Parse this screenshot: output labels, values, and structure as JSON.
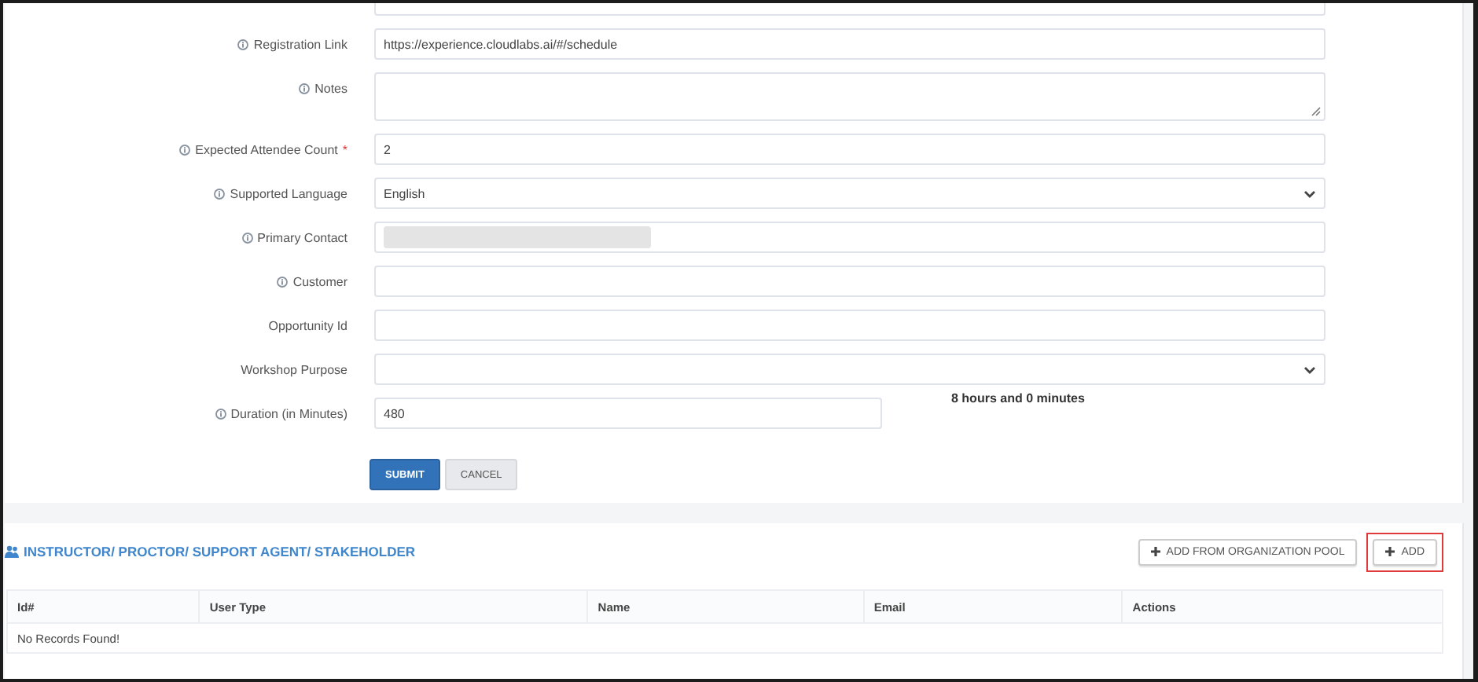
{
  "form": {
    "top_cut_field": true,
    "rows": [
      {
        "label": "Registration Link",
        "info": true,
        "required": false,
        "kind": "text",
        "value": "https://experience.cloudlabs.ai/#/schedule"
      },
      {
        "label": "Notes",
        "info": true,
        "required": false,
        "kind": "textarea"
      },
      {
        "label": "Expected Attendee Count",
        "info": true,
        "required": true,
        "required_mark": "*",
        "kind": "text",
        "value": "2"
      },
      {
        "label": "Supported Language",
        "info": true,
        "required": false,
        "kind": "select",
        "value": "English"
      },
      {
        "label": "Primary Contact",
        "info": true,
        "required": false,
        "kind": "blurred"
      },
      {
        "label": "Customer",
        "info": true,
        "required": false,
        "kind": "text"
      },
      {
        "label": "Opportunity Id",
        "info": false,
        "required": false,
        "kind": "text"
      },
      {
        "label": "Workshop Purpose",
        "info": false,
        "required": false,
        "kind": "select"
      },
      {
        "label": "Duration (in Minutes)",
        "info": true,
        "required": false,
        "kind": "short",
        "value": "480",
        "note": "8 hours and 0 minutes"
      }
    ],
    "buttons": [
      {
        "label": "SUBMIT",
        "kind": "primary"
      },
      {
        "label": "CANCEL",
        "kind": "secondary"
      }
    ]
  },
  "section": {
    "title": "INSTRUCTOR/ PROCTOR/ SUPPORT AGENT/ STAKEHOLDER",
    "buttons": [
      {
        "label": "ADD FROM ORGANIZATION POOL",
        "highlighted": false
      },
      {
        "label": "ADD",
        "highlighted": true
      }
    ],
    "table": {
      "columns": [
        "Id#",
        "User Type",
        "Name",
        "Email",
        "Actions"
      ],
      "empty_text": "No Records Found!"
    }
  }
}
